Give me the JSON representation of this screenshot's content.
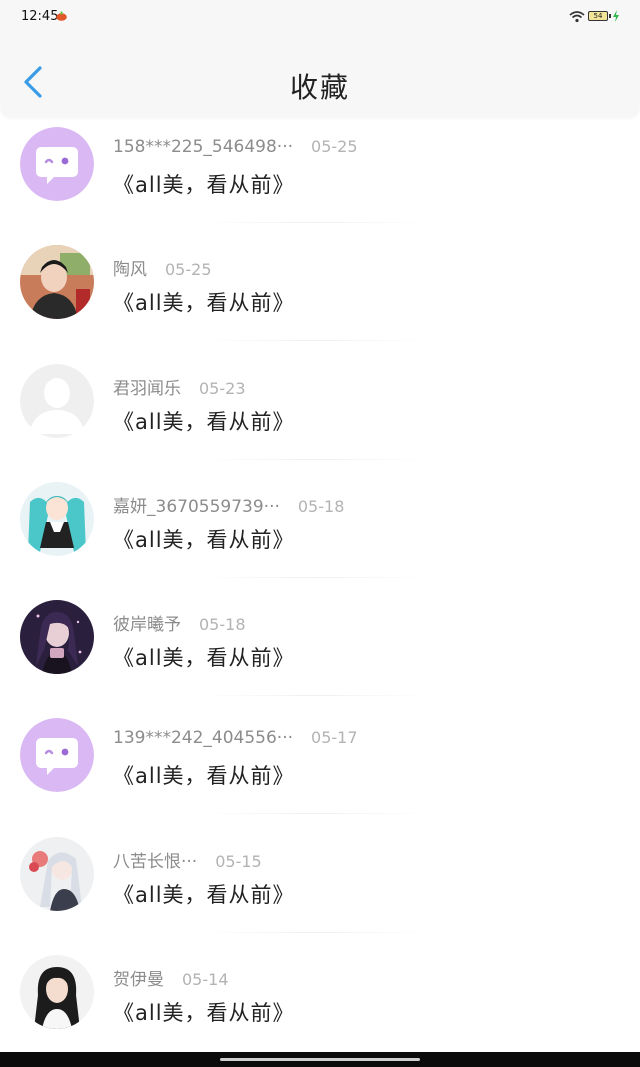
{
  "status_bar": {
    "time": "12:45",
    "battery_level": "54"
  },
  "header": {
    "title": "收藏",
    "back_icon": "chevron-left-icon",
    "accent_color": "#3a9be6"
  },
  "items": [
    {
      "name": "158***225_546498···",
      "date": "05-25",
      "content": "《all美，看从前》",
      "avatar": "default-chat-avatar"
    },
    {
      "name": "陶风",
      "date": "05-25",
      "content": "《all美，看从前》",
      "avatar": "photo-avatar"
    },
    {
      "name": "君羽闻乐",
      "date": "05-23",
      "content": "《all美，看从前》",
      "avatar": "placeholder-avatar"
    },
    {
      "name": "嘉妍_3670559739···",
      "date": "05-18",
      "content": "《all美，看从前》",
      "avatar": "anime-avatar"
    },
    {
      "name": "彼岸曦予",
      "date": "05-18",
      "content": "《all美，看从前》",
      "avatar": "dark-anime-avatar"
    },
    {
      "name": "139***242_404556···",
      "date": "05-17",
      "content": "《all美，看从前》",
      "avatar": "default-chat-avatar"
    },
    {
      "name": "八苦长恨···",
      "date": "05-15",
      "content": "《all美，看从前》",
      "avatar": "anime-avatar"
    },
    {
      "name": "贺伊曼",
      "date": "05-14",
      "content": "《all美，看从前》",
      "avatar": "photo-avatar"
    }
  ]
}
